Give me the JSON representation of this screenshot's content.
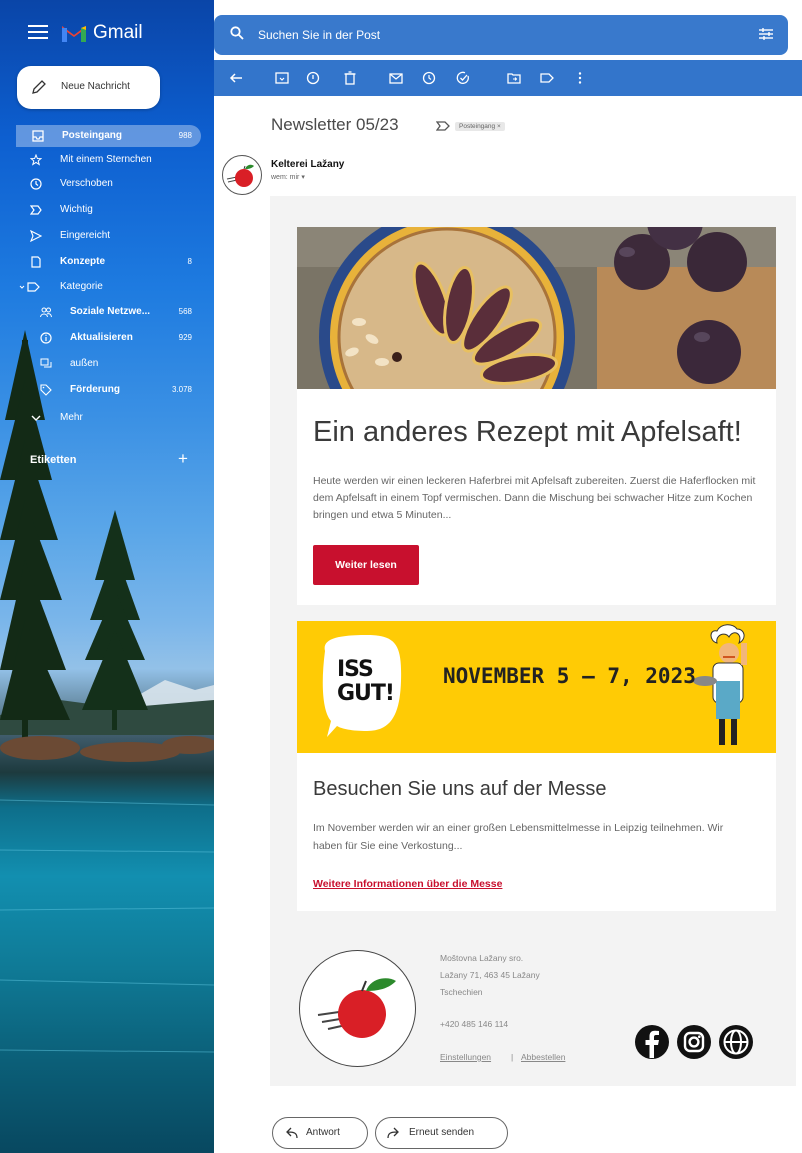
{
  "app": {
    "name": "Gmail"
  },
  "search": {
    "placeholder": "Suchen Sie in der Post"
  },
  "compose": {
    "label": "Neue Nachricht"
  },
  "sidebar": {
    "items": [
      {
        "label": "Posteingang",
        "count": "988",
        "icon": "inbox-icon"
      },
      {
        "label": "Mit einem Sternchen",
        "count": "",
        "icon": "star-icon"
      },
      {
        "label": "Verschoben",
        "count": "",
        "icon": "clock-icon"
      },
      {
        "label": "Wichtig",
        "count": "",
        "icon": "important-icon"
      },
      {
        "label": "Eingereicht",
        "count": "",
        "icon": "send-icon"
      },
      {
        "label": "Konzepte",
        "count": "8",
        "icon": "draft-icon"
      },
      {
        "label": "Kategorie",
        "count": "",
        "icon": "label-icon"
      },
      {
        "label": "Soziale Netzwe...",
        "count": "568",
        "icon": "people-icon"
      },
      {
        "label": "Aktualisieren",
        "count": "929",
        "icon": "info-icon"
      },
      {
        "label": "außen",
        "count": "",
        "icon": "forum-icon"
      },
      {
        "label": "Förderung",
        "count": "3.078",
        "icon": "tag-icon"
      },
      {
        "label": "Mehr",
        "count": "",
        "icon": "chevron-down-icon"
      }
    ],
    "labels_heading": "Etiketten",
    "labels_add": "+"
  },
  "mail": {
    "subject": "Newsletter 05/23",
    "label_chip": "Posteingang ×",
    "sender": "Kelterei Lažany",
    "to": "wem: mir"
  },
  "newsletter": {
    "article1": {
      "title": "Ein anderes Rezept mit Apfelsaft!",
      "text": "Heute werden wir einen leckeren Haferbrei mit Apfelsaft zubereiten. Zuerst die Haferflocken mit dem Apfelsaft in einem Topf vermischen. Dann die Mischung bei schwacher Hitze zum Kochen bringen und etwa 5 Minuten...",
      "button": "Weiter lesen"
    },
    "banner": {
      "logo_line1": "ISS",
      "logo_line2": "GUT!",
      "date": "NOVEMBER 5 – 7, 2023"
    },
    "article2": {
      "title": "Besuchen Sie uns auf der Messe",
      "text": "Im November werden wir an einer großen Lebensmittelmesse in Leipzig teilnehmen. Wir haben für Sie eine Verkostung...",
      "link": "Weitere Informationen über die Messe"
    },
    "footer": {
      "company": "Moštovna Lažany sro.",
      "street": "Lažany 71, 463 45 Lažany",
      "country": "Tschechien",
      "phone": "+420  485 146 114",
      "settings": "Einstellungen",
      "separator": "|",
      "unsubscribe": "Abbestellen"
    }
  },
  "actions": {
    "reply": "Antwort",
    "forward": "Erneut senden"
  },
  "colors": {
    "accent_red": "#c8102e",
    "banner_yellow": "#ffcb05"
  }
}
